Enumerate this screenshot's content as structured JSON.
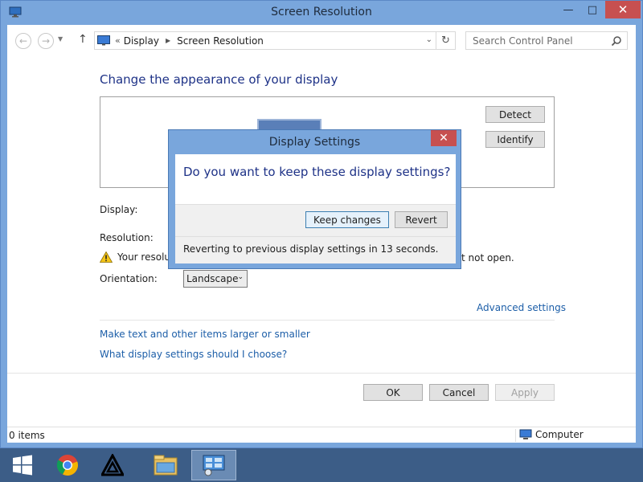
{
  "window": {
    "title": "Screen Resolution",
    "controls": {
      "minimize": "—",
      "maximize": "□",
      "close": "✕"
    }
  },
  "nav": {
    "breadcrumb_sep": "«",
    "crumbs": [
      "Display",
      "Screen Resolution"
    ],
    "search_placeholder": "Search Control Panel"
  },
  "main": {
    "heading": "Change the appearance of your display",
    "detect_label": "Detect",
    "identify_label": "Identify",
    "display_label": "Display:",
    "resolution_label": "Resolution:",
    "warning_text": "Your resolut",
    "warning_tail": "t not open.",
    "orientation_label": "Orientation:",
    "orientation_value": "Landscape",
    "advanced_link": "Advanced settings",
    "text_size_link": "Make text and other items larger or smaller",
    "help_link": "What display settings should I choose?",
    "ok_label": "OK",
    "cancel_label": "Cancel",
    "apply_label": "Apply"
  },
  "status": {
    "items": "0 items",
    "location": "Computer"
  },
  "dialog": {
    "title": "Display Settings",
    "close": "✕",
    "question": "Do you want to keep these display settings?",
    "keep_label": "Keep changes",
    "revert_label": "Revert",
    "countdown": "Reverting to previous display settings in 13 seconds."
  },
  "taskbar": {
    "items": [
      "windows-start",
      "chrome",
      "app-triangle",
      "file-explorer",
      "control-panel"
    ]
  },
  "colors": {
    "accent": "#79a6dc",
    "link": "#1c5ea8",
    "heading": "#1e3287",
    "close_red": "#c75050"
  }
}
